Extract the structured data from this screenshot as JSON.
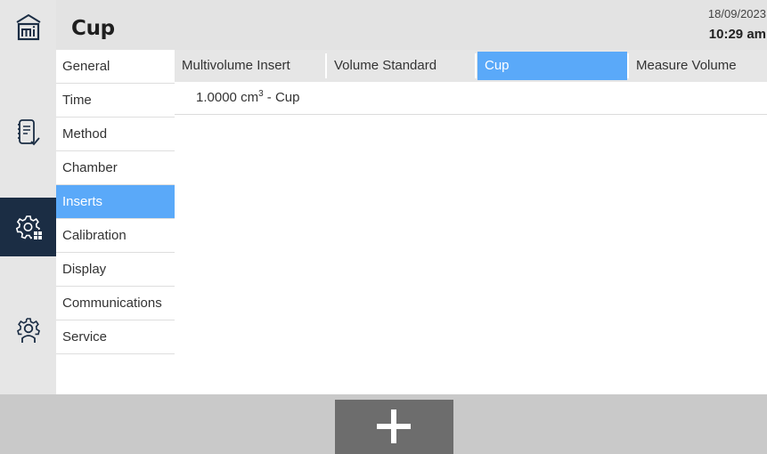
{
  "header": {
    "title": "Cup",
    "date": "18/09/2023",
    "time": "10:29 am"
  },
  "rail": [
    {
      "icon": "home-logo-icon"
    },
    {
      "icon": "checklist-icon"
    },
    {
      "icon": "settings-grid-icon",
      "active": true
    },
    {
      "icon": "user-settings-icon"
    }
  ],
  "menu": {
    "items": [
      {
        "label": "General"
      },
      {
        "label": "Time"
      },
      {
        "label": "Method"
      },
      {
        "label": "Chamber"
      },
      {
        "label": "Inserts",
        "active": true
      },
      {
        "label": "Calibration"
      },
      {
        "label": "Display"
      },
      {
        "label": "Communications"
      },
      {
        "label": "Service"
      }
    ]
  },
  "tabs": [
    {
      "label": "Multivolume Insert"
    },
    {
      "label": "Volume Standard"
    },
    {
      "label": "Cup",
      "active": true
    },
    {
      "label": "Measure Volume"
    }
  ],
  "list": [
    {
      "value": "1.0000",
      "unit_base": "cm",
      "unit_exp": "3",
      "name": "- Cup"
    }
  ],
  "footer": {
    "add_icon": "plus-icon"
  },
  "colors": {
    "accent": "#5aa9f9",
    "rail_active": "#1b2d44",
    "footer_button": "#6d6d6d"
  }
}
